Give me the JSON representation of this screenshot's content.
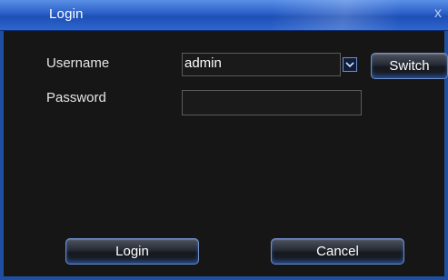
{
  "window": {
    "title": "Login",
    "close_glyph": "x"
  },
  "form": {
    "username_label": "Username",
    "username_value": "admin",
    "switch_label": "Switch",
    "password_label": "Password",
    "password_value": ""
  },
  "actions": {
    "login_label": "Login",
    "cancel_label": "Cancel"
  },
  "icons": {
    "dropdown": "chevron-down-icon",
    "close": "close-icon"
  },
  "colors": {
    "title_bar": "#2a5fc7",
    "dialog_background": "#161616",
    "button_glow": "#286ee6"
  }
}
